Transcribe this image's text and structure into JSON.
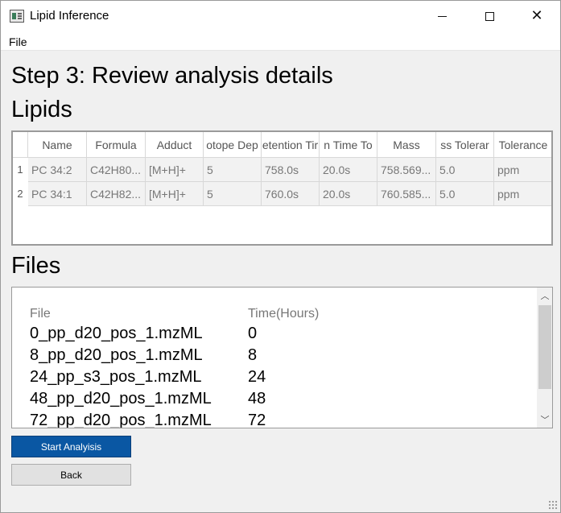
{
  "window": {
    "title": "Lipid Inference",
    "minimize_icon": "minimize-icon",
    "maximize_icon": "maximize-icon",
    "close_icon": "close-icon",
    "close_glyph": "✕"
  },
  "menubar": {
    "items": [
      {
        "label": "File"
      }
    ]
  },
  "step_title": "Step 3: Review analysis details",
  "lipids": {
    "title": "Lipids",
    "columns": [
      "Name",
      "Formula",
      "Adduct",
      "otope Dep",
      "etention Tir",
      "n Time To",
      "Mass",
      "ss Tolerar",
      "Tolerance"
    ],
    "rows": [
      {
        "num": "1",
        "cells": [
          "PC 34:2",
          "C42H80...",
          "[M+H]+",
          "5",
          "758.0s",
          "20.0s",
          "758.569...",
          "5.0",
          "ppm"
        ]
      },
      {
        "num": "2",
        "cells": [
          "PC 34:1",
          "C42H82...",
          "[M+H]+",
          "5",
          "760.0s",
          "20.0s",
          "760.585...",
          "5.0",
          "ppm"
        ]
      }
    ]
  },
  "files": {
    "title": "Files",
    "header_file": "File",
    "header_time": "Time(Hours)",
    "items": [
      {
        "name": "0_pp_d20_pos_1.mzML",
        "time": "0"
      },
      {
        "name": "8_pp_d20_pos_1.mzML",
        "time": "8"
      },
      {
        "name": "24_pp_s3_pos_1.mzML",
        "time": "24"
      },
      {
        "name": "48_pp_d20_pos_1.mzML",
        "time": "48"
      },
      {
        "name": "72_pp_d20_pos_1.mzML",
        "time": "72"
      }
    ],
    "scroll_up_glyph": "︿",
    "scroll_down_glyph": "﹀"
  },
  "buttons": {
    "start": "Start Analyisis",
    "back": "Back"
  },
  "colors": {
    "primary_button": "#0a57a3",
    "window_bg": "#f0f0f0"
  }
}
